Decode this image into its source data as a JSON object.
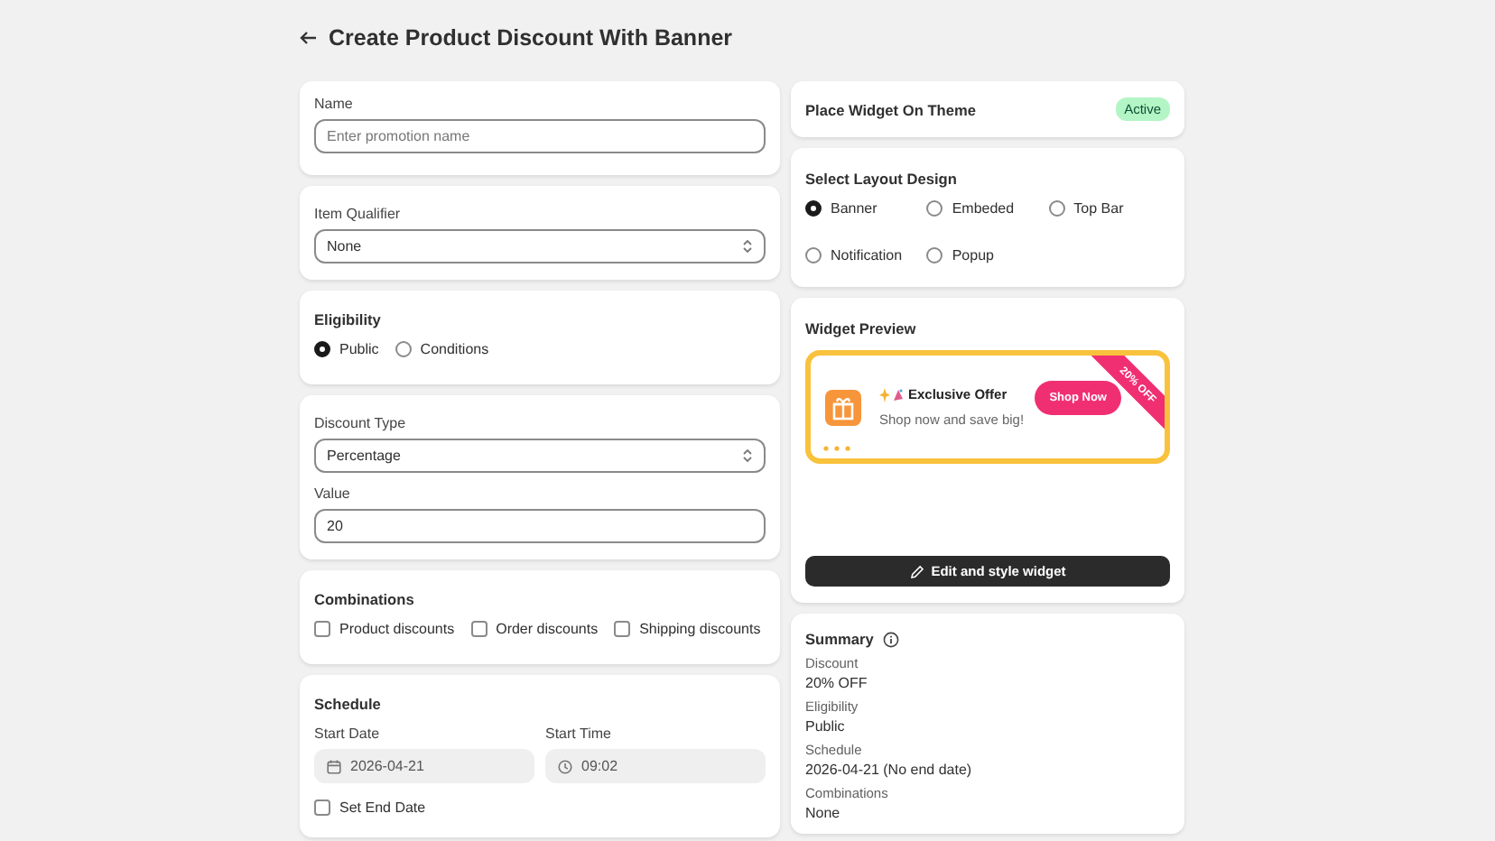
{
  "page": {
    "title": "Create Product Discount With Banner"
  },
  "name_field": {
    "label": "Name",
    "placeholder": "Enter promotion name"
  },
  "item_qualifier": {
    "label": "Item Qualifier",
    "value": "None"
  },
  "eligibility": {
    "title": "Eligibility",
    "options": [
      {
        "label": "Public",
        "selected": true
      },
      {
        "label": "Conditions",
        "selected": false
      }
    ]
  },
  "discount": {
    "type_label": "Discount Type",
    "type_value": "Percentage",
    "value_label": "Value",
    "value": "20"
  },
  "combinations": {
    "title": "Combinations",
    "options": [
      {
        "label": "Product discounts",
        "checked": false
      },
      {
        "label": "Order discounts",
        "checked": false
      },
      {
        "label": "Shipping discounts",
        "checked": false
      }
    ]
  },
  "schedule": {
    "title": "Schedule",
    "start_date": {
      "label": "Start Date",
      "value": "2026-04-21"
    },
    "start_time": {
      "label": "Start Time",
      "value": "09:02"
    },
    "end_date": {
      "label": "Set End Date",
      "checked": false
    }
  },
  "place_widget": {
    "title": "Place Widget On Theme",
    "badge": "Active"
  },
  "layout_design": {
    "title": "Select Layout Design",
    "options": [
      {
        "label": "Banner",
        "selected": true
      },
      {
        "label": "Embeded",
        "selected": false
      },
      {
        "label": "Top Bar",
        "selected": false
      },
      {
        "label": "Notification",
        "selected": false
      },
      {
        "label": "Popup",
        "selected": false
      }
    ]
  },
  "widget_preview": {
    "title": "Widget Preview",
    "banner": {
      "title": "Exclusive Offer",
      "subtitle": "Shop now and save big!",
      "button": "Shop Now",
      "ribbon": "20% OFF"
    },
    "edit_button": "Edit and style widget"
  },
  "summary": {
    "title": "Summary",
    "items": [
      {
        "label": "Discount",
        "value": "20% OFF"
      },
      {
        "label": "Eligibility",
        "value": "Public"
      },
      {
        "label": "Schedule",
        "value": "2026-04-21 (No end date)"
      },
      {
        "label": "Combinations",
        "value": "None"
      }
    ]
  }
}
